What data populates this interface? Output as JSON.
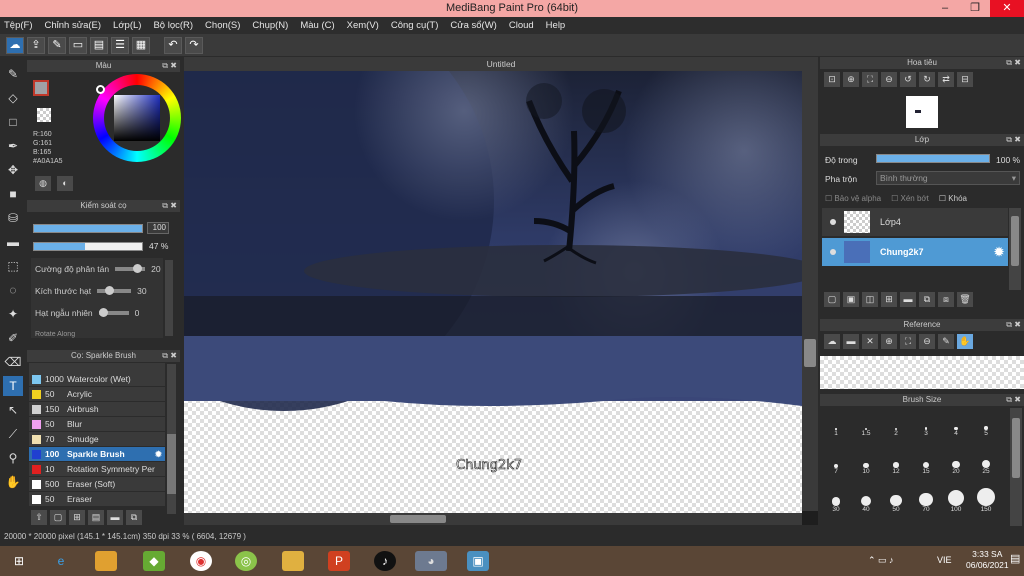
{
  "window": {
    "title": "MediBang Paint Pro (64bit)",
    "minimize": "–",
    "maximize": "❐",
    "close": "✕"
  },
  "menu": [
    "Tệp(F)",
    "Chỉnh sửa(E)",
    "Lớp(L)",
    "Bộ lọc(R)",
    "Chọn(S)",
    "Chụp(N)",
    "Màu (C)",
    "Xem(V)",
    "Công cụ(T)",
    "Cửa sổ(W)",
    "Cloud",
    "Help"
  ],
  "color_panel": {
    "title": "Màu",
    "r": "R:160",
    "g": "G:161",
    "b": "B:165",
    "hex": "#A0A1A5",
    "accent": "#A0A1A5"
  },
  "control_panel": {
    "title": "Kiểm soát cọ",
    "size_value": "100",
    "opacity_value": "47 %",
    "opacity_fraction": 0.47,
    "rows": [
      {
        "label": "Cường độ phân tán",
        "value": "20"
      },
      {
        "label": "Kích thước hạt",
        "value": "30"
      },
      {
        "label": "Hạt ngẫu nhiên",
        "value": "0"
      }
    ],
    "cut_row": "Rotate Along"
  },
  "brush_panel": {
    "title": "Cọ: Sparkle Brush",
    "items": [
      {
        "size": "1000",
        "name": "Watercolor (Wet)",
        "color": "#7dc7f0"
      },
      {
        "size": "50",
        "name": "Acrylic",
        "color": "#f0d020"
      },
      {
        "size": "150",
        "name": "Airbrush",
        "color": "#d0d0d0"
      },
      {
        "size": "50",
        "name": "Blur",
        "color": "#f0a0f0"
      },
      {
        "size": "70",
        "name": "Smudge",
        "color": "#f0e0b0"
      },
      {
        "size": "100",
        "name": "Sparkle Brush",
        "color": "#2040d0"
      },
      {
        "size": "10",
        "name": "Rotation Symmetry Per",
        "color": "#e02020"
      },
      {
        "size": "500",
        "name": "Eraser (Soft)",
        "color": "#ffffff"
      },
      {
        "size": "50",
        "name": "Eraser",
        "color": "#ffffff"
      }
    ]
  },
  "document": {
    "tab": "Untitled",
    "watermark": "Chung2k7"
  },
  "status": {
    "text": "20000 * 20000 pixel  (145.1 * 145.1cm)  350 dpi  33 %  ( 6604, 12679 )"
  },
  "navigator": {
    "title": "Hoa tiêu"
  },
  "layer_panel": {
    "title": "Lớp",
    "opacity_label": "Độ trong",
    "opacity_value": "100 %",
    "blend_label": "Pha trộn",
    "blend_value": "Bình thường",
    "protect_alpha": "Bảo vệ alpha",
    "clipping": "Xén bớt",
    "lock": "Khóa",
    "layers": [
      {
        "name": "Lớp4",
        "selected": false
      },
      {
        "name": "Chung2k7",
        "selected": true
      }
    ]
  },
  "reference": {
    "title": "Reference"
  },
  "brush_size": {
    "title": "Brush Size",
    "sizes": [
      "1",
      "1.5",
      "2",
      "3",
      "4",
      "5",
      "7",
      "10",
      "12",
      "15",
      "20",
      "25",
      "30",
      "40",
      "50",
      "70",
      "100",
      "150"
    ]
  },
  "taskbar": {
    "time": "3:33 SA",
    "date": "06/06/2021",
    "lang": "VIE"
  }
}
